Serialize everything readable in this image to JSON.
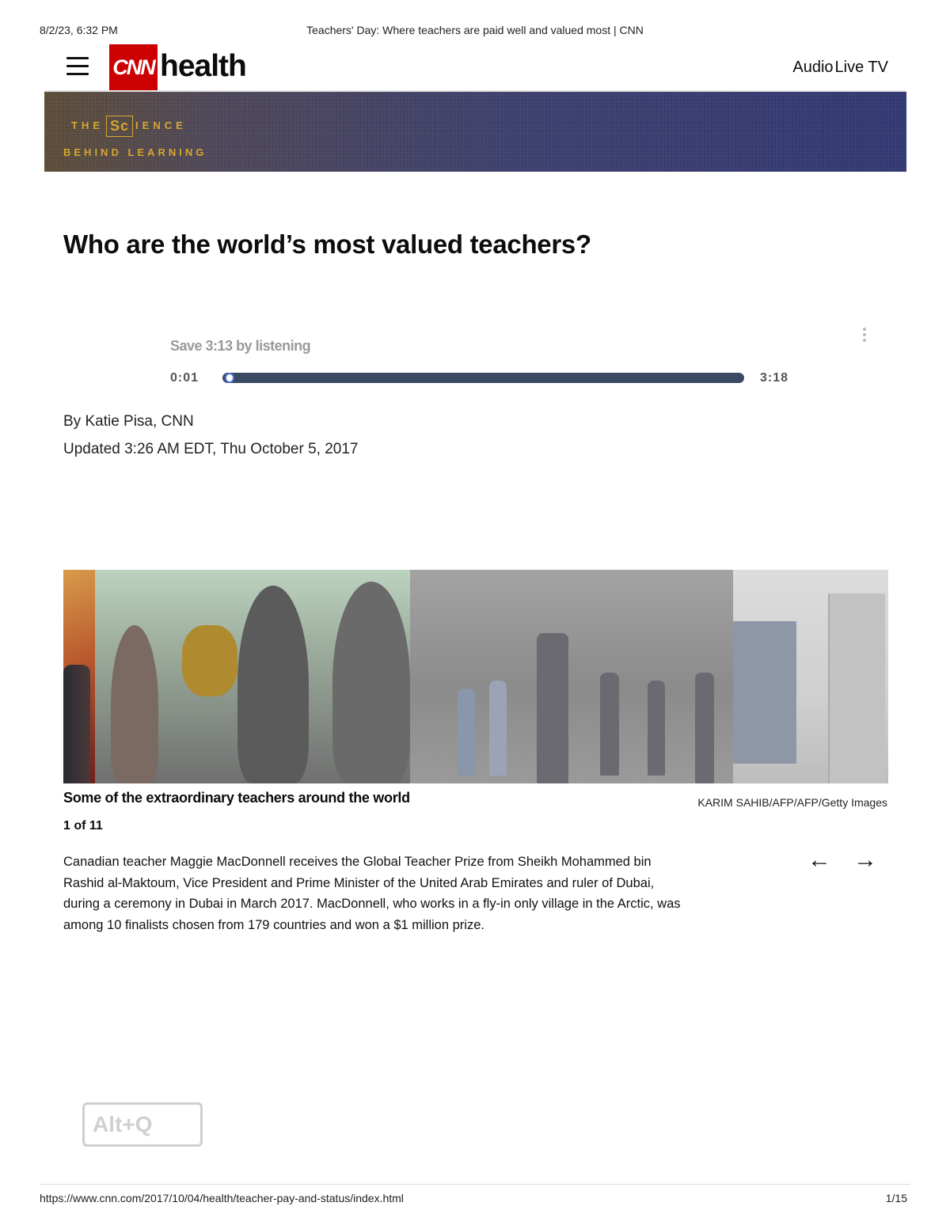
{
  "print_header": {
    "datetime": "8/2/23, 6:32 PM",
    "title": "Teachers' Day: Where teachers are paid well and valued most | CNN"
  },
  "print_footer": {
    "url": "https://www.cnn.com/2017/10/04/health/teacher-pay-and-status/index.html",
    "page": "1/15"
  },
  "header": {
    "menu_icon": "hamburger-menu-icon",
    "logo_text": "CNN",
    "section": "health",
    "nav": [
      "Audio",
      "Live TV"
    ],
    "brand_color": "#cc0000"
  },
  "banner": {
    "line1_prefix": "THE",
    "line1_box": "Sc",
    "line1_suffix": "IENCE",
    "line2": "BEHIND LEARNING",
    "accent_color": "#d6a630"
  },
  "article": {
    "headline": "Who are the world’s most valued teachers?",
    "byline": "By Katie Pisa, CNN",
    "updated": "Updated 3:26 AM EDT, Thu October 5, 2017"
  },
  "audio": {
    "save_text": "Save 3:13 by listening",
    "current_time": "0:01",
    "duration": "3:18",
    "progress_fraction": 0.005,
    "more_icon": "more-vertical-icon"
  },
  "gallery": {
    "caption_title": "Some of the extraordinary teachers around the world",
    "credit": "KARIM SAHIB/AFP/AFP/Getty Images",
    "counter": "1 of 11",
    "caption": "Canadian teacher Maggie MacDonnell receives the Global Teacher Prize from Sheikh Mohammed bin Rashid al-Maktoum, Vice President and Prime Minister of the United Arab Emirates and ruler of Dubai, during a ceremony in Dubai in March 2017. MacDonnell, who works in a fly-in only village in the Arctic, was among 10 finalists chosen from 179 countries and won a $1 million prize.",
    "prev_icon": "arrow-left-icon",
    "next_icon": "arrow-right-icon",
    "prev_glyph": "←",
    "next_glyph": "→"
  },
  "shortcut_hint": "Alt+Q"
}
